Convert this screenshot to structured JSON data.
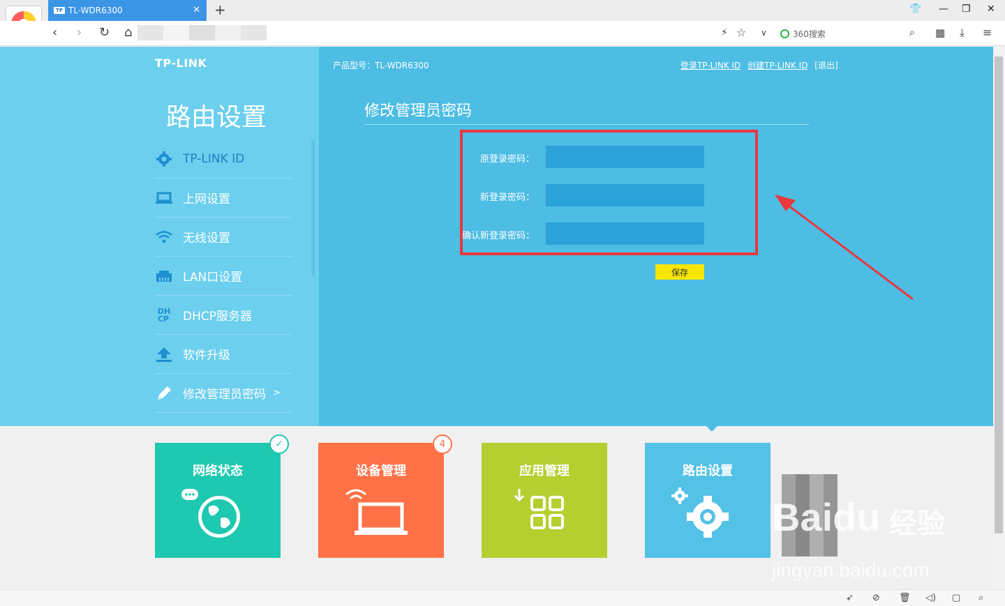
{
  "browser": {
    "tab_title": "TL-WDR6300",
    "tab_favicon": "TP",
    "search_placeholder": "360搜索"
  },
  "router": {
    "brand": "TP-LINK",
    "sidebar_title": "路由设置",
    "menu": [
      {
        "label": "TP-LINK ID",
        "icon": "gear-icon"
      },
      {
        "label": "上网设置",
        "icon": "laptop-icon"
      },
      {
        "label": "无线设置",
        "icon": "wifi-icon"
      },
      {
        "label": "LAN口设置",
        "icon": "lan-port-icon"
      },
      {
        "label": "DHCP服务器",
        "icon": "dhcp-icon"
      },
      {
        "label": "软件升级",
        "icon": "upload-icon"
      },
      {
        "label": "修改管理员密码",
        "icon": "pencil-icon",
        "arrow": ">"
      }
    ],
    "model_label": "产品型号：TL-WDR6300",
    "links": {
      "login": "登录TP-LINK ID",
      "create": "创建TP-LINK ID",
      "logout": "[退出]"
    },
    "form": {
      "title": "修改管理员密码",
      "old_password_label": "原登录密码：",
      "new_password_label": "新登录密码：",
      "confirm_password_label": "确认新登录密码：",
      "save_label": "保存"
    },
    "tiles": [
      {
        "label": "网络状态",
        "color": "#1fc8b0",
        "badge": "✓",
        "badge_color": "#1fc8b0"
      },
      {
        "label": "设备管理",
        "color": "#ff7247",
        "badge": "4",
        "badge_color": "#ff7247"
      },
      {
        "label": "应用管理",
        "color": "#b5cf31",
        "badge": "",
        "badge_color": ""
      },
      {
        "label": "路由设置",
        "color": "#54c1e6",
        "badge": "",
        "badge_color": ""
      }
    ]
  },
  "colors": {
    "annotation_red": "#e8383d"
  },
  "watermark": {
    "brand": "Bai",
    "brand2": "du",
    "cn": "经验",
    "url": "jingyan.baidu.com"
  }
}
